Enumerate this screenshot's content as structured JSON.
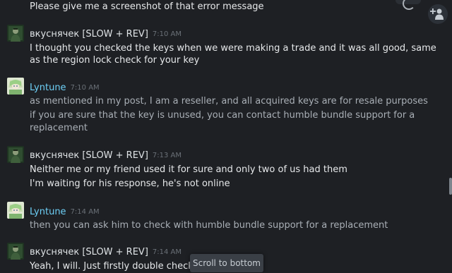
{
  "chat": {
    "top_message": "Please give me a screenshot of that error message",
    "groups": [
      {
        "author": "вкуснячек [SLOW + REV]",
        "time": "7:10 AM",
        "lines": [
          "I thought you checked the keys when we were making a trade and it was all good, same",
          "as the region lock check for your key"
        ]
      },
      {
        "author": "Lyntune",
        "time": "7:10 AM",
        "lines": [
          "as mentioned in my post, I am a reseller, and all acquired keys are for resale purposes",
          "if you are sure that the key is unused, you can contact humble bundle support for a",
          "replacement"
        ]
      },
      {
        "author": "вкуснячек [SLOW + REV]",
        "time": "7:13 AM",
        "lines": [
          "Neither me or my friend used it for sure and only two of us had them",
          "I'm waiting for his response, he's not online"
        ]
      },
      {
        "author": "Lyntune",
        "time": "7:14 AM",
        "lines": [
          "then you can ask him to check with humble bundle support for a replacement"
        ]
      },
      {
        "author": "вкуснячек [SLOW + REV]",
        "time": "7:14 AM",
        "lines": [
          "Yeah, I will. Just firstly double check"
        ]
      }
    ],
    "scroll_to_bottom_label": "Scroll to bottom"
  },
  "icons": {
    "add_friend": "add-friend-icon",
    "spinner": "loading-spinner-icon"
  },
  "colors": {
    "background": "#1e2024",
    "friend_name": "#6dcff6",
    "self_name": "#dfe3e6",
    "own_message_text": "#e6e8ea",
    "friend_message_text": "#a9afb6",
    "timestamp": "#6a7077"
  }
}
